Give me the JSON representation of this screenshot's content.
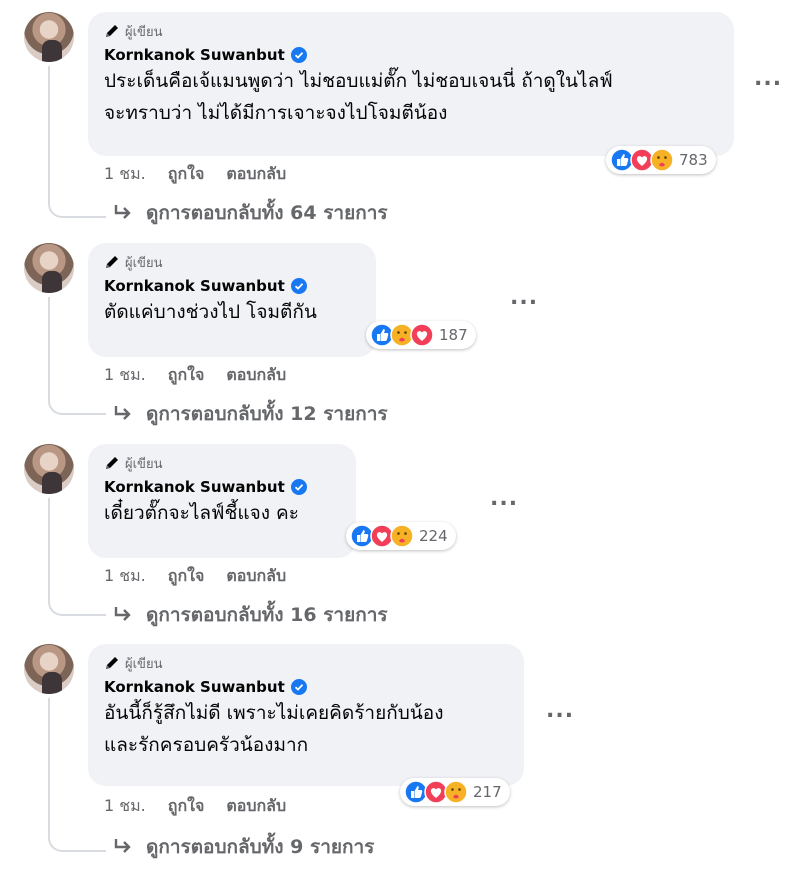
{
  "comments": [
    {
      "badge": "ผู้เขียน",
      "author": "Kornkanok Suwanbut",
      "lines": [
        "ประเด็นคือเจ้แมนพูดว่า ไม่ชอบแม่ตั๊ก ไม่ชอบเจนนี่ ถ้าดูในไลฟ์",
        "จะทราบว่า ไม่ได้มีการเจาะจงไปโจมตีน้อง"
      ],
      "reaction_count": "783",
      "reactions": [
        "like-icon",
        "love-icon",
        "care-icon"
      ],
      "time": "1 ชม.",
      "like_label": "ถูกใจ",
      "reply_label": "ตอบกลับ",
      "view_replies": "ดูการตอบกลับทั้ง 64 รายการ"
    },
    {
      "badge": "ผู้เขียน",
      "author": "Kornkanok Suwanbut",
      "lines": [
        "ตัดแค่บางช่วงไป โจมตีกัน"
      ],
      "reaction_count": "187",
      "reactions": [
        "like-icon",
        "care-icon",
        "love-icon"
      ],
      "time": "1 ชม.",
      "like_label": "ถูกใจ",
      "reply_label": "ตอบกลับ",
      "view_replies": "ดูการตอบกลับทั้ง 12 รายการ"
    },
    {
      "badge": "ผู้เขียน",
      "author": "Kornkanok Suwanbut",
      "lines": [
        "เดี๋ยวตั๊กจะไลฟ์ชี้แจง คะ"
      ],
      "reaction_count": "224",
      "reactions": [
        "like-icon",
        "love-icon",
        "care-icon"
      ],
      "time": "1 ชม.",
      "like_label": "ถูกใจ",
      "reply_label": "ตอบกลับ",
      "view_replies": "ดูการตอบกลับทั้ง 16 รายการ"
    },
    {
      "badge": "ผู้เขียน",
      "author": "Kornkanok Suwanbut",
      "lines": [
        "อันนี้ก็รู้สึกไม่ดี เพราะไม่เคยคิดร้ายกับน้อง",
        "และรักครอบครัวน้องมาก"
      ],
      "reaction_count": "217",
      "reactions": [
        "like-icon",
        "love-icon",
        "care-icon"
      ],
      "time": "1 ชม.",
      "like_label": "ถูกใจ",
      "reply_label": "ตอบกลับ",
      "view_replies": "ดูการตอบกลับทั้ง 9 รายการ"
    }
  ],
  "more_label": "...",
  "colors": {
    "like": "#1877f2",
    "love": "#f33e58",
    "care": "#f7b125",
    "bubble": "#f0f2f5",
    "meta": "#65676b"
  }
}
